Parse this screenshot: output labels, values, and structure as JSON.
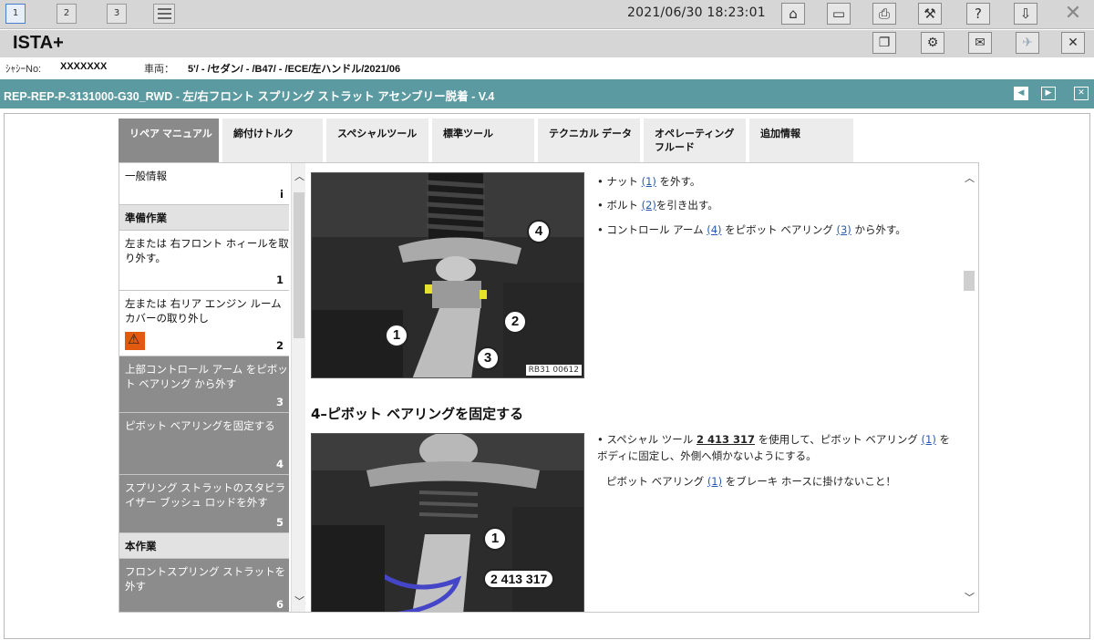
{
  "toolbar": {
    "pages": [
      "1",
      "2",
      "3"
    ],
    "datetime": "2021/06/30 18:23:01"
  },
  "app": {
    "title": "ISTA+"
  },
  "vehicle": {
    "vin_label": "ｼｬｼｰNo:",
    "vin": "XXXXXXX",
    "car_label": "車両：",
    "car": "5'/ - /セダン/ - /B47/ - /ECE/左ハンドル/2021/06"
  },
  "document": {
    "title": "REP-REP-P-3131000-G30_RWD - 左/右フロント スプリング ストラット アセンブリー脱着 - V.4"
  },
  "tabs": [
    {
      "label": "リペア マニュアル"
    },
    {
      "label": "締付けトルク"
    },
    {
      "label": "スペシャルツール"
    },
    {
      "label": "標準ツール"
    },
    {
      "label": "テクニカル データ"
    },
    {
      "label": "オペレーティング フルード"
    },
    {
      "label": "追加情報"
    }
  ],
  "sidebar": {
    "items": [
      {
        "label": "一般情報",
        "num": "i"
      },
      {
        "label": "準備作業"
      },
      {
        "label": "左または 右フロント ホィールを取り外す。",
        "num": "1"
      },
      {
        "label": "左または 右リア エンジン ルーム カバーの取り外し",
        "num": "2"
      },
      {
        "label": "上部コントロール アーム をピボット ベアリング から外す",
        "num": "3"
      },
      {
        "label": "ピボット ベアリングを固定する",
        "num": "4"
      },
      {
        "label": "スプリング ストラットのスタビライザー ブッシュ ロッドを外す",
        "num": "5"
      },
      {
        "label": "本作業"
      },
      {
        "label": "フロントスプリング ストラットを外す",
        "num": "6"
      }
    ]
  },
  "main": {
    "figure1": {
      "caption": "RB31 00612",
      "callouts": [
        "1",
        "2",
        "3",
        "4"
      ]
    },
    "steps1": [
      {
        "pre": "ナット ",
        "link": "(1)",
        "post": " を外す。"
      },
      {
        "pre": "ボルト ",
        "link": "(2)",
        "post": "を引き出す。"
      },
      {
        "pre": "コントロール アーム ",
        "link": "(4)",
        "mid": " をピボット ベアリング ",
        "link2": "(3)",
        "post": " から外す。"
      }
    ],
    "section_title": "4–ピボット ベアリングを固定する",
    "figure2": {
      "callout": "1",
      "tool": "2 413 317"
    },
    "step2": {
      "pre": "スペシャル ツール ",
      "tool": "2 413 317",
      "mid": " を使用して、ピボット ベアリング ",
      "link": "(1)",
      "post": " をボディに固定し、外側へ傾かないようにする。"
    },
    "note": {
      "pre": "ピボット ベアリング ",
      "link": "(1)",
      "post": " をブレーキ ホースに掛けないこと！"
    }
  }
}
